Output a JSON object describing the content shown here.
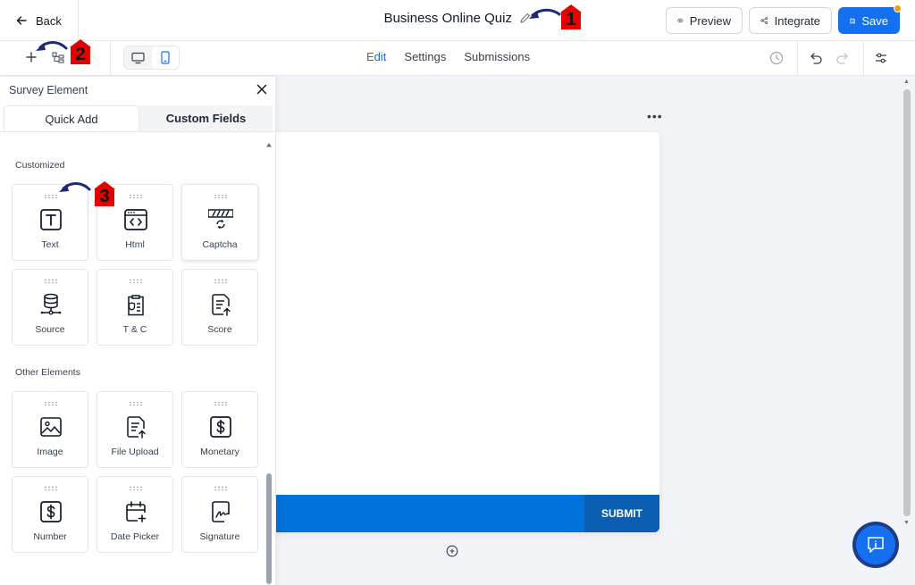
{
  "header": {
    "back_label": "Back",
    "title": "Business Online Quiz",
    "preview_label": "Preview",
    "integrate_label": "Integrate",
    "save_label": "Save"
  },
  "toolbar": {
    "tabs": [
      {
        "label": "Edit",
        "active": true
      },
      {
        "label": "Settings",
        "active": false
      },
      {
        "label": "Submissions",
        "active": false
      }
    ],
    "device_active": "mobile"
  },
  "panel": {
    "title": "Survey Element",
    "tabs": [
      "Quick Add",
      "Custom Fields"
    ],
    "sections": [
      {
        "label": "Customized",
        "items": [
          {
            "label": "Text",
            "icon": "text-icon"
          },
          {
            "label": "Html",
            "icon": "html-icon"
          },
          {
            "label": "Captcha",
            "icon": "captcha-icon"
          },
          {
            "label": "Source",
            "icon": "source-icon"
          },
          {
            "label": "T & C",
            "icon": "terms-icon"
          },
          {
            "label": "Score",
            "icon": "score-icon"
          }
        ]
      },
      {
        "label": "Other Elements",
        "items": [
          {
            "label": "Image",
            "icon": "image-icon"
          },
          {
            "label": "File Upload",
            "icon": "file-upload-icon"
          },
          {
            "label": "Monetary",
            "icon": "monetary-icon"
          },
          {
            "label": "Number",
            "icon": "number-icon"
          },
          {
            "label": "Date Picker",
            "icon": "date-picker-icon"
          },
          {
            "label": "Signature",
            "icon": "signature-icon"
          }
        ]
      }
    ]
  },
  "form": {
    "submit_label": "SUBMIT"
  },
  "annotations": [
    "1",
    "2",
    "3"
  ],
  "colors": {
    "accent": "#1570ef",
    "submit_bar": "#0072d9",
    "submit_button": "#0a5fb3",
    "annotation_badge": "#e60000",
    "annotation_arrow": "#1e2a78"
  }
}
